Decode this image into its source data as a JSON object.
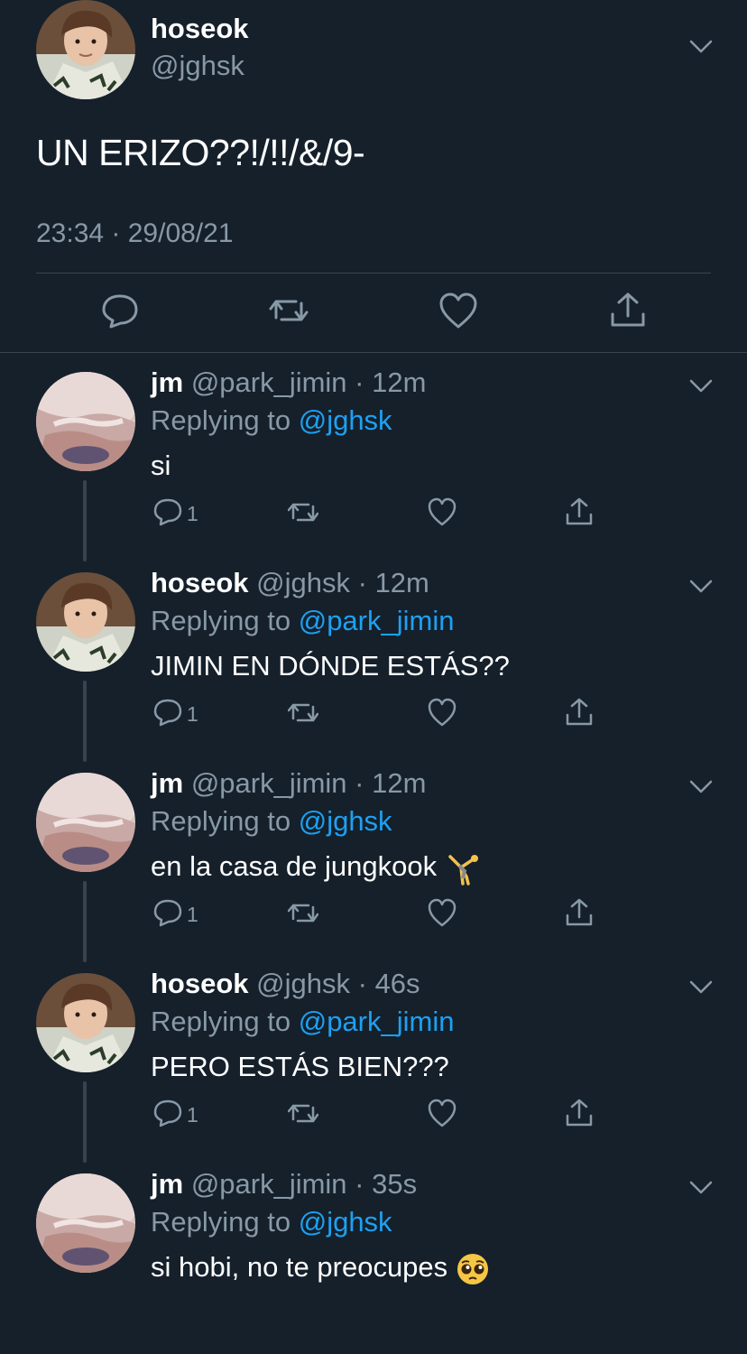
{
  "main_tweet": {
    "display_name": "hoseok",
    "handle": "@jghsk",
    "text": "UN ERIZO??!/!!/&/9-",
    "timestamp": "23:34 · 29/08/21",
    "actions": [
      "reply-icon",
      "retweet-icon",
      "like-icon",
      "share-icon"
    ]
  },
  "replies": [
    {
      "display_name": "jm",
      "handle": "@park_jimin",
      "age": "12m",
      "replying_prefix": "Replying to ",
      "replying_to": "@jghsk",
      "text": "si",
      "reply_count": "1",
      "avatar": "jimin"
    },
    {
      "display_name": "hoseok",
      "handle": "@jghsk",
      "age": "12m",
      "replying_prefix": "Replying to ",
      "replying_to": "@park_jimin",
      "text": "JIMIN EN DÓNDE ESTÁS??",
      "reply_count": "1",
      "avatar": "hoseok"
    },
    {
      "display_name": "jm",
      "handle": "@park_jimin",
      "age": "12m",
      "replying_prefix": "Replying to ",
      "replying_to": "@jghsk",
      "text": "en la casa de jungkook",
      "emoji": "cartwheel-emoji",
      "reply_count": "1",
      "avatar": "jimin"
    },
    {
      "display_name": "hoseok",
      "handle": "@jghsk",
      "age": "46s",
      "replying_prefix": "Replying to ",
      "replying_to": "@park_jimin",
      "text": "PERO ESTÁS BIEN???",
      "reply_count": "1",
      "avatar": "hoseok"
    },
    {
      "display_name": "jm",
      "handle": "@park_jimin",
      "age": "35s",
      "replying_prefix": "Replying to ",
      "replying_to": "@jghsk",
      "text": "si hobi, no te preocupes",
      "emoji": "pleading-face-emoji",
      "reply_count": "",
      "avatar": "jimin"
    }
  ],
  "colors": {
    "background": "#15202b",
    "secondary_text": "#8899a6",
    "link": "#1da1f2",
    "divider": "#38444d"
  }
}
